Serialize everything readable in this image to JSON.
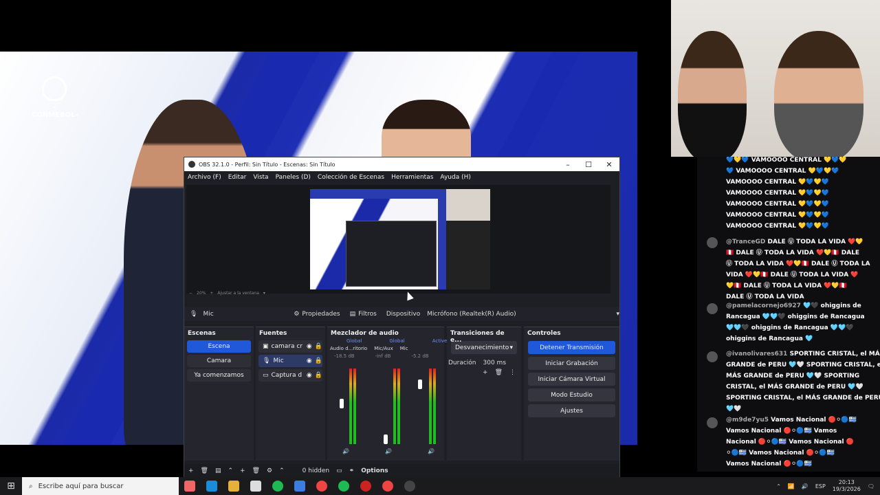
{
  "obs": {
    "title": "OBS 32.1.0 - Perfil: Sin Título - Escenas: Sin Título",
    "menu": [
      "Archivo (F)",
      "Editar",
      "Vista",
      "Paneles (D)",
      "Colección de Escenas",
      "Herramientas",
      "Ayuda (H)"
    ],
    "zoom": "20%",
    "fit": "Ajustar a la ventana",
    "source_selected": "Mic",
    "properties": "Propiedades",
    "filters": "Filtros",
    "device_label": "Dispositivo",
    "device_value": "Micrófono (Realtek(R) Audio)",
    "scenes": {
      "title": "Escenas",
      "items": [
        "Escena",
        "Camara",
        "Ya comenzamos"
      ],
      "selected": 0
    },
    "sources": {
      "title": "Fuentes",
      "items": [
        "camara cr",
        "Mic",
        "Captura d"
      ]
    },
    "mixer": {
      "title": "Mezclador de audio",
      "tags": [
        "Global",
        "Global",
        "Active"
      ],
      "channels": [
        {
          "name": "Audio d...ritorio",
          "db": "-18.5 dB"
        },
        {
          "name": "Mic/Aux",
          "db": "-inf dB"
        },
        {
          "name": "Mic",
          "db": "-5.2 dB"
        }
      ]
    },
    "transitions": {
      "title": "Transiciones de e...",
      "value": "Desvanecimiento",
      "duration_label": "Duración",
      "duration_value": "300 ms"
    },
    "controls": {
      "title": "Controles",
      "buttons": [
        "Detener Transmisión",
        "Iniciar Grabación",
        "Iniciar Cámara Virtual",
        "Modo Estudio",
        "Ajustes"
      ]
    },
    "bottom": {
      "hidden": "0 hidden",
      "options": "Options"
    }
  },
  "stage": {
    "logo_text": "-CONMEBOL-"
  },
  "chat": {
    "messages": [
      {
        "user": "",
        "lines": [
          "💙💛💙 VAMOOOO CENTRAL 💛💙💛",
          "💙 VAMOOOO CENTRAL 💛💙💛💙",
          "VAMOOOO CENTRAL 💛💙💛💙",
          "VAMOOOO CENTRAL 💛💙💛💙",
          "VAMOOOO CENTRAL 💛💙💛💙",
          "VAMOOOO CENTRAL 💛💙💛💙",
          "VAMOOOO CENTRAL 💛💙💛💙"
        ]
      },
      {
        "user": "@TranceGD",
        "lines": [
          "DALE Ⓤ TODA LA VIDA ❤️💛",
          "🇵🇪 DALE Ⓤ TODA LA VIDA ❤️💛🇵🇪 DALE",
          "Ⓤ TODA LA VIDA ❤️💛🇵🇪 DALE Ⓤ TODA LA",
          "VIDA ❤️💛🇵🇪 DALE Ⓤ TODA LA VIDA ❤️",
          "💛🇵🇪 DALE Ⓤ TODA LA VIDA ❤️💛🇵🇪",
          "DALE Ⓤ TODA LA VIDA"
        ]
      },
      {
        "user": "@pamelacornejo6927",
        "lines": [
          "🩵🖤 ohiggins de",
          "Rancagua 🩵🩵🖤 ohiggins de Rancagua",
          "🩵🩵🖤 ohiggins de Rancagua 🩵🩵🖤",
          "ohiggins de Rancagua 🩵"
        ]
      },
      {
        "user": "@ivanolivares631",
        "lines": [
          "SPORTING CRISTAL, el MÁS",
          "GRANDE de PERU 🩵🤍 SPORTING CRISTAL, el",
          "MÁS GRANDE de PERU 🩵🤍 SPORTING",
          "CRISTAL, el MÁS GRANDE de PERU 🩵🤍",
          "SPORTING CRISTAL, el MÁS GRANDE de PERU",
          "🩵🤍"
        ]
      },
      {
        "user": "@m9de7yu5",
        "lines": [
          "Vamos Nacional 🔴⚪🔵🇺🇾",
          "Vamos Nacional 🔴⚪🔵🇺🇾 Vamos",
          "Nacional 🔴⚪🔵🇺🇾 Vamos Nacional 🔴",
          "⚪🔵🇺🇾 Vamos Nacional 🔴⚪🔵🇺🇾",
          "Vamos Nacional 🔴⚪🔵🇺🇾"
        ]
      }
    ]
  },
  "taskbar": {
    "search_placeholder": "Escribe aquí para buscar",
    "lang": "ESP",
    "time": "20:13",
    "date": "19/3/2026"
  }
}
